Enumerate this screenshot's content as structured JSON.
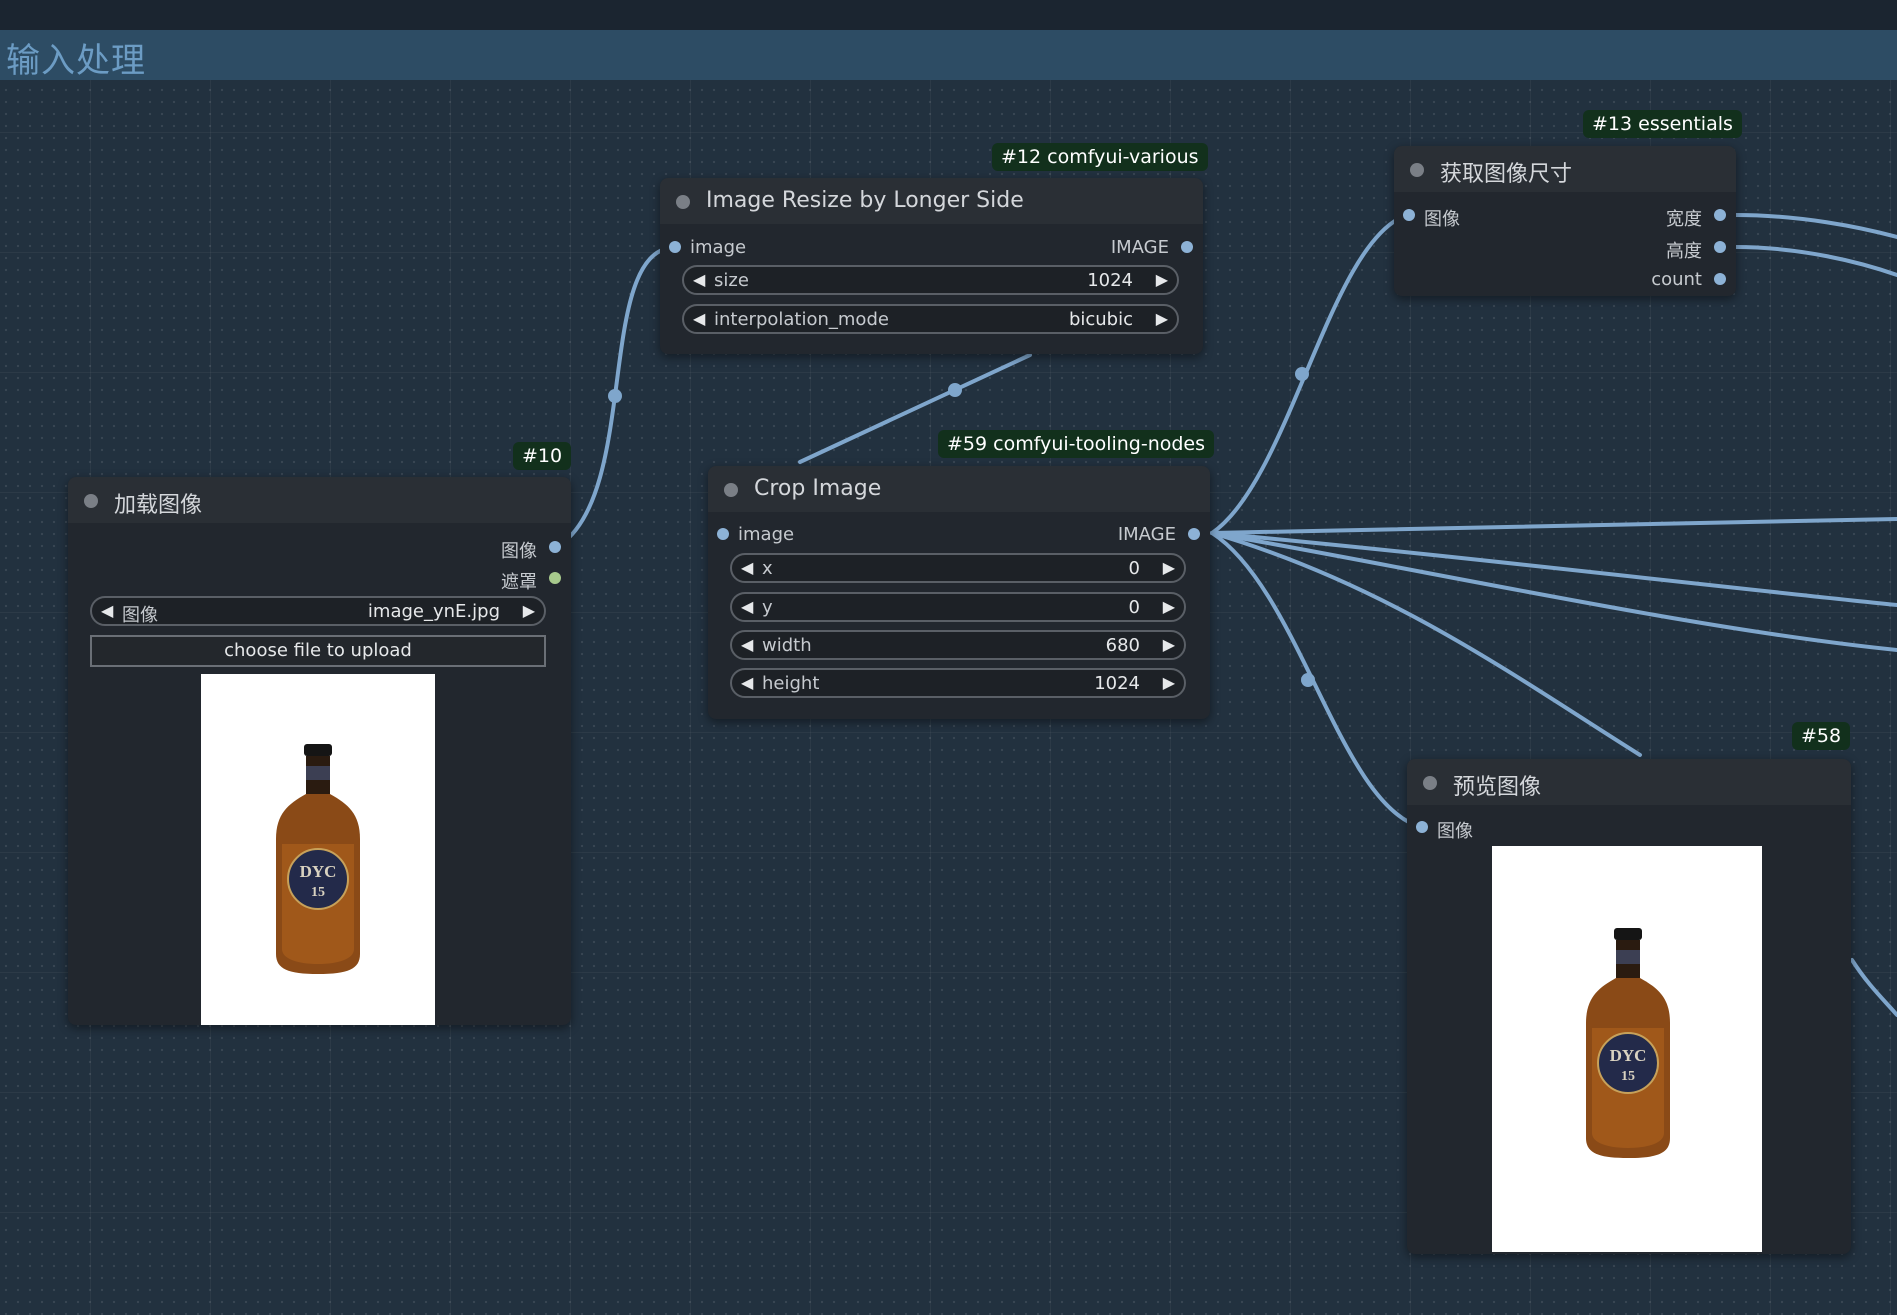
{
  "group": {
    "title": "输入处理"
  },
  "nodes": {
    "load_image": {
      "badge": "#10",
      "title": "加载图像",
      "outputs": [
        "图像",
        "遮罩"
      ],
      "widget": {
        "name": "图像",
        "value": "image_ynE.jpg"
      },
      "upload_label": "choose file to upload",
      "preview": {
        "bottle_label": "DYC",
        "bottle_number": "15"
      }
    },
    "resize": {
      "badge": "#12 comfyui-various",
      "title": "Image Resize by Longer Side",
      "input": "image",
      "output": "IMAGE",
      "widgets": [
        {
          "name": "size",
          "value": "1024"
        },
        {
          "name": "interpolation_mode",
          "value": "bicubic"
        }
      ]
    },
    "crop": {
      "badge": "#59 comfyui-tooling-nodes",
      "title": "Crop Image",
      "input": "image",
      "output": "IMAGE",
      "widgets": [
        {
          "name": "x",
          "value": "0"
        },
        {
          "name": "y",
          "value": "0"
        },
        {
          "name": "width",
          "value": "680"
        },
        {
          "name": "height",
          "value": "1024"
        }
      ]
    },
    "size": {
      "badge": "#13 essentials",
      "title": "获取图像尺寸",
      "input": "图像",
      "outputs": [
        "宽度",
        "高度",
        "count"
      ]
    },
    "preview": {
      "badge": "#58",
      "title": "预览图像",
      "input": "图像",
      "preview": {
        "bottle_label": "DYC",
        "bottle_number": "15"
      }
    }
  },
  "icons": {
    "left_arrow": "◀",
    "right_arrow": "▶"
  },
  "colors": {
    "wire": "#7fa6cc",
    "image_slot": "#8db2d6",
    "mask_slot": "#a7c98c",
    "badge_bg": "#12301c",
    "group_bar": "#2d4c64",
    "group_title": "#6c9cc4"
  }
}
